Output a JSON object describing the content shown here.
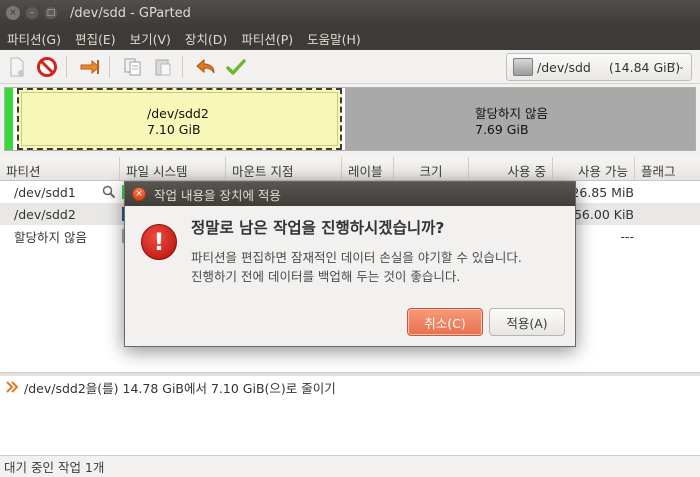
{
  "window": {
    "title": "/dev/sdd - GParted",
    "close_glyph": "×",
    "min_glyph": "–",
    "max_glyph": "□"
  },
  "menu": [
    "파티션(G)",
    "편집(E)",
    "보기(V)",
    "장치(D)",
    "파티션(P)",
    "도움말(H)"
  ],
  "toolbar": {
    "icons": [
      "new-partition-icon",
      "delete-icon",
      "resize-move-icon",
      "copy-icon",
      "paste-icon",
      "undo-icon",
      "apply-icon"
    ],
    "device": "/dev/sdd",
    "device_size": "(14.84 GiB)",
    "dropdown_arrow": "⌃⌄"
  },
  "graphic": {
    "p1_name": "/dev/sdd2",
    "p1_size": "7.10 GiB",
    "p2_name": "할당하지 않음",
    "p2_size": "7.69 GiB",
    "colors": {
      "p1": "#f7f7b7",
      "p2": "#a9a9a9",
      "sel": "#39d939"
    }
  },
  "table": {
    "headers": [
      "파티션",
      "파일 시스템",
      "마운트 지점",
      "레이블",
      "크기",
      "사용 중",
      "사용 가능",
      "플래그"
    ],
    "rows": [
      {
        "name": "/dev/sdd1",
        "tail": "26.85 MiB",
        "fs_color": "#39d939"
      },
      {
        "name": "/dev/sdd2",
        "tail": "356.00 KiB",
        "fs_color": "#2e5a8a"
      },
      {
        "name": "할당하지 않음",
        "tail": "---",
        "fs_color": "#a9a9a9"
      }
    ]
  },
  "operations": {
    "items": [
      "/dev/sdd2을(를) 14.78 GiB에서 7.10 GiB(으)로 줄이기"
    ]
  },
  "status": "대기 중인 작업 1개",
  "dialog": {
    "title": "작업 내용을 장치에 적용",
    "heading": "정말로 남은 작업을 진행하시겠습니까?",
    "line1": "파티션을 편집하면 잠재적인 데이터 손실을 야기할 수 있습니다.",
    "line2": "진행하기 전에 데이터를 백업해 두는 것이 좋습니다.",
    "icon_glyph": "!",
    "cancel": "취소(C)",
    "apply": "적용(A)"
  }
}
